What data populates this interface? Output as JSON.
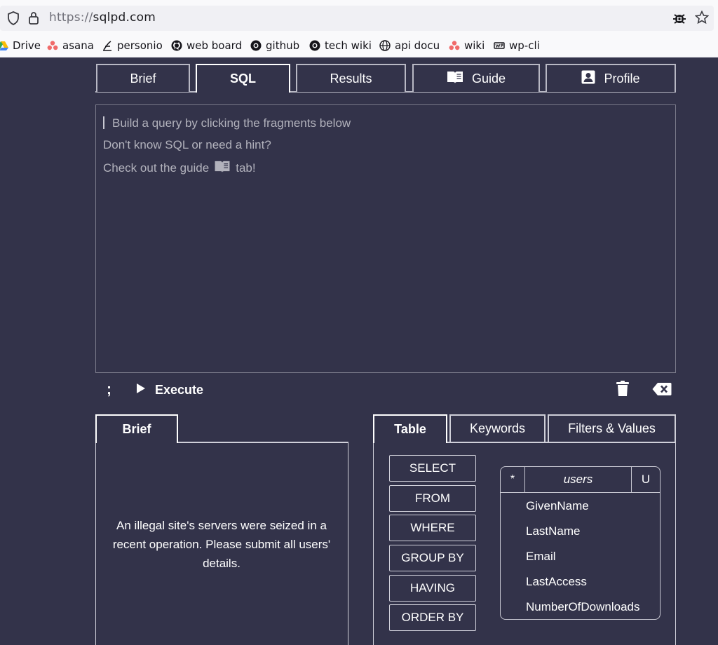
{
  "browser": {
    "url_scheme": "https://",
    "url_host": "sqlpd.com",
    "bookmarks": [
      {
        "label": "Drive",
        "icon": "google-drive-icon"
      },
      {
        "label": "asana",
        "icon": "asana-icon"
      },
      {
        "label": "personio",
        "icon": "personio-icon"
      },
      {
        "label": "web board",
        "icon": "github-icon"
      },
      {
        "label": "github",
        "icon": "github-icon"
      },
      {
        "label": "tech wiki",
        "icon": "github-icon"
      },
      {
        "label": "api docu",
        "icon": "globe-icon"
      },
      {
        "label": "wiki",
        "icon": "asana-icon"
      },
      {
        "label": "wp-cli",
        "icon": "wp-icon"
      }
    ]
  },
  "tabs": [
    {
      "label": "Brief",
      "icon": ""
    },
    {
      "label": "SQL",
      "icon": ""
    },
    {
      "label": "Results",
      "icon": ""
    },
    {
      "label": "Guide",
      "icon": "book-icon"
    },
    {
      "label": "Profile",
      "icon": "profile-icon"
    }
  ],
  "active_tab": "SQL",
  "editor": {
    "line1": "Build a query by clicking the fragments below",
    "line2": "Don't know SQL or need a hint?",
    "line3_pre": "Check out the guide",
    "line3_post": "tab!"
  },
  "toolbar": {
    "semicolon": ";",
    "execute_label": "Execute"
  },
  "brief_panel": {
    "tab_label": "Brief",
    "text": "An illegal site's servers were seized in a recent operation. Please submit all users' details."
  },
  "fragment_tabs": [
    "Table",
    "Keywords",
    "Filters & Values"
  ],
  "keywords": [
    "SELECT",
    "FROM",
    "WHERE",
    "GROUP BY",
    "HAVING",
    "ORDER BY"
  ],
  "table": {
    "star": "*",
    "name": "users",
    "u": "U",
    "columns": [
      "GivenName",
      "LastName",
      "Email",
      "LastAccess",
      "NumberOfDownloads"
    ]
  },
  "colors": {
    "background": "#33334a",
    "text": "#ffffff",
    "hint": "#b2b2bc",
    "border": "#d0d0da"
  }
}
